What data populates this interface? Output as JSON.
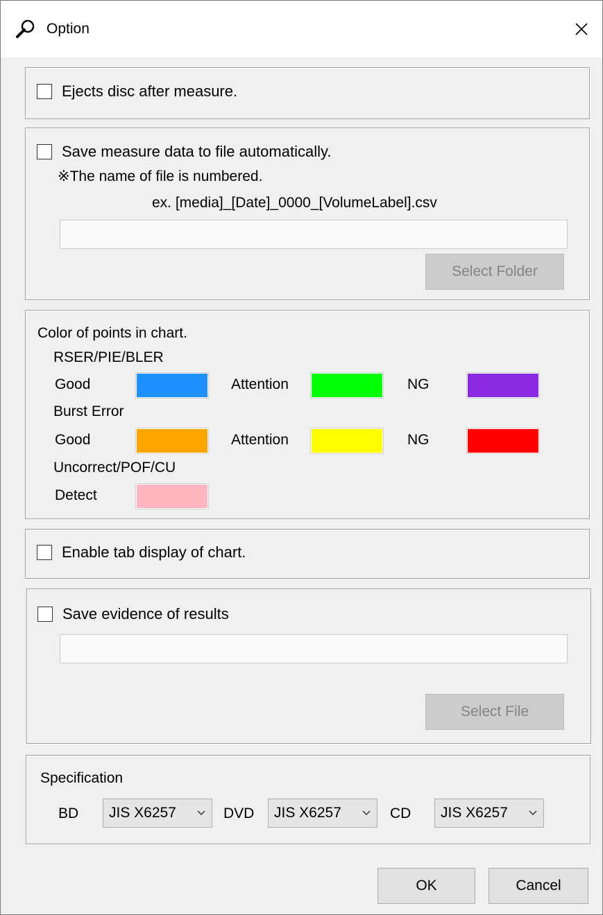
{
  "window": {
    "title": "Option",
    "title_icon": "wrench-icon",
    "close_icon": "close-icon"
  },
  "eject": {
    "checked": false,
    "label": "Ejects disc after measure."
  },
  "autosave": {
    "checked": false,
    "label": "Save measure data to file automatically.",
    "note": "※The name of file is numbered.",
    "example": "ex. [media]_[Date]_0000_[VolumeLabel].csv",
    "path_value": "",
    "select_button": "Select Folder"
  },
  "colors": {
    "heading": "Color of points in chart.",
    "rser": {
      "label": "RSER/PIE/BLER",
      "good_label": "Good",
      "good_color": "#1e90ff",
      "attention_label": "Attention",
      "attention_color": "#00ff00",
      "ng_label": "NG",
      "ng_color": "#8a2be2"
    },
    "burst": {
      "label": "Burst Error",
      "good_label": "Good",
      "good_color": "#ffa500",
      "attention_label": "Attention",
      "attention_color": "#ffff00",
      "ng_label": "NG",
      "ng_color": "#ff0000"
    },
    "uncorrect": {
      "label": "Uncorrect/POF/CU",
      "detect_label": "Detect",
      "detect_color": "#ffb6c1"
    }
  },
  "tab_display": {
    "checked": false,
    "label": "Enable tab display of chart."
  },
  "evidence": {
    "checked": false,
    "label": "Save evidence of results",
    "path_value": "",
    "select_button": "Select File"
  },
  "spec": {
    "heading": "Specification",
    "bd_label": "BD",
    "bd_value": "JIS X6257",
    "dvd_label": "DVD",
    "dvd_value": "JIS X6257",
    "cd_label": "CD",
    "cd_value": "JIS X6257"
  },
  "footer": {
    "ok": "OK",
    "cancel": "Cancel"
  }
}
